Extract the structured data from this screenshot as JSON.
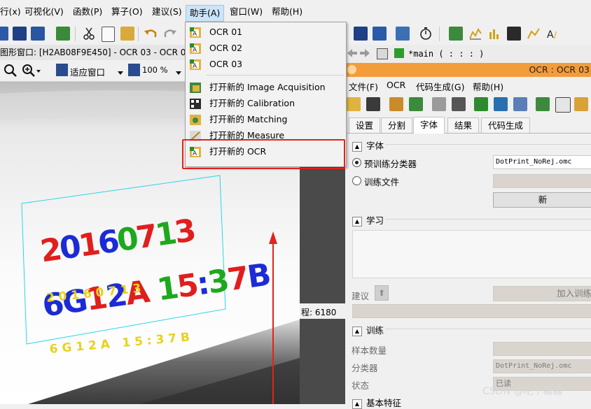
{
  "menubar": {
    "items": [
      "行(x)",
      "可视化(V)",
      "函数(P)",
      "算子(O)",
      "建议(S)",
      "助手(A)",
      "窗口(W)",
      "帮助(H)"
    ]
  },
  "dropdown": {
    "items": [
      "OCR 01",
      "OCR 02",
      "OCR 03",
      "打开新的 Image Acquisition",
      "打开新的 Calibration",
      "打开新的 Matching",
      "打开新的 Measure",
      "打开新的 OCR"
    ]
  },
  "graphics_window": {
    "title": "图形窗口: [H2AB08F9E450] - OCR 03 - OCR 03",
    "fit_window": "适应窗口",
    "zoom": "100 %",
    "overlay_line1": "2 0 1 6 0 7 1 3",
    "overlay_line2": "6 G 1 2 A   1 5 : 3 7 B",
    "dots_line1": "20160713",
    "dots_line2": "6G12A 15:37B"
  },
  "status": {
    "text": "程: 6180"
  },
  "editor": {
    "tab_title": "*main ( : : : )"
  },
  "ocr_panel": {
    "title": "OCR : OCR 03",
    "menus": [
      "文件(F)",
      "OCR",
      "代码生成(G)",
      "帮助(H)"
    ],
    "tabs": [
      "设置",
      "分割",
      "字体",
      "结果",
      "代码生成"
    ],
    "active_tab": "字体",
    "font_section": "字体",
    "pretrained_label": "预训练分类器",
    "pretrained_value": "DotPrint_NoRej.omc",
    "train_file_label": "训练文件",
    "new_button": "新",
    "learn_section": "学习",
    "suggest_label": "建议",
    "add_train_button": "加入训练",
    "train_section": "训练",
    "sample_count_label": "样本数量",
    "classifier_label": "分类器",
    "classifier_value": "DotPrint_NoRej.omc",
    "status_label": "状态",
    "status_value": "已读",
    "basic_features_section": "基本特征"
  },
  "watermark": "CSDN @吃个糖糖",
  "colors": {
    "accent_orange": "#f39c3a",
    "highlight_red": "#e2231a",
    "menu_active": "#cce4f7",
    "dot_red": "#e11e1e",
    "dot_blue": "#1c2bd6",
    "dot_green": "#1ea81e",
    "overlay_yellow": "#e8d21a",
    "cyan_box": "#27d7e6"
  }
}
